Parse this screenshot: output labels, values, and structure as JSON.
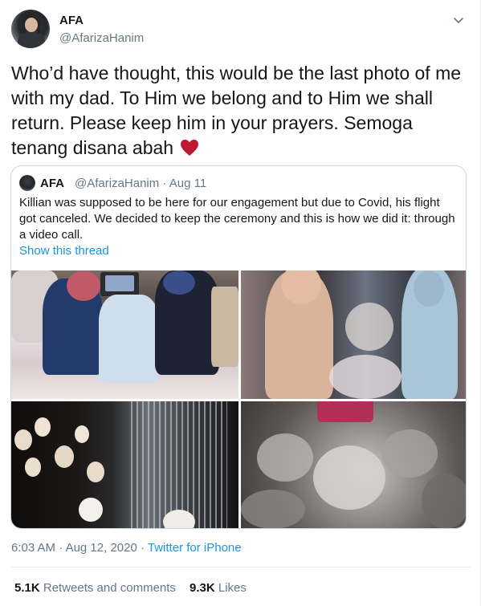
{
  "author": {
    "name": "AFA",
    "handle": "@AfarizaHanim"
  },
  "tweet": {
    "text": "Who’d have thought, this would be the last photo of me with my dad. To Him we belong and to Him we shall return. Please keep him in your prayers. Semoga tenang disana abah",
    "emoji": "red-heart-icon"
  },
  "quoted_tweet": {
    "name": "AFA",
    "handle": "@AfarizaHanim",
    "separator": "·",
    "date": "Aug 11",
    "text": "Killian was supposed to be here for our engagement but due to Covid, his flight got canceled. We decided to keep the ceremony and this is how we did it: through a video call.",
    "show_thread": "Show this thread"
  },
  "meta": {
    "time": "6:03 AM",
    "separator": "·",
    "date": "Aug 12, 2020",
    "source": "Twitter for iPhone"
  },
  "stats": {
    "retweets_count": "5.1K",
    "retweets_label": "Retweets and comments",
    "likes_count": "9.3K",
    "likes_label": "Likes"
  },
  "colors": {
    "link": "#1b95e0",
    "secondary_text": "#657786",
    "heart": "#be1931"
  }
}
